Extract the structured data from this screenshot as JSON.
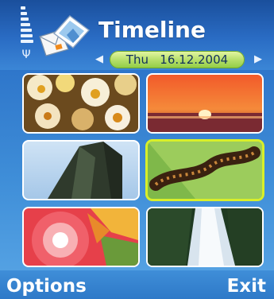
{
  "header": {
    "title": "Timeline",
    "app_icon": "timeline-app-icon",
    "signal_icon": "signal-strength-icon",
    "antenna_icon": "antenna-icon"
  },
  "date_bar": {
    "day": "Thu",
    "date": "16.12.2004",
    "prev_icon": "arrow-left-icon",
    "next_icon": "arrow-right-icon"
  },
  "thumbnails": [
    {
      "subject": "flowers"
    },
    {
      "subject": "sunset"
    },
    {
      "subject": "rock-cliff"
    },
    {
      "subject": "caterpillar",
      "selected": true
    },
    {
      "subject": "abstract-swirl"
    },
    {
      "subject": "waterfall"
    }
  ],
  "softkeys": {
    "left": "Options",
    "right": "Exit"
  },
  "colors": {
    "background": "#2d74c9",
    "selection": "#d8ef2a",
    "date_pill": "#b8e06c"
  }
}
